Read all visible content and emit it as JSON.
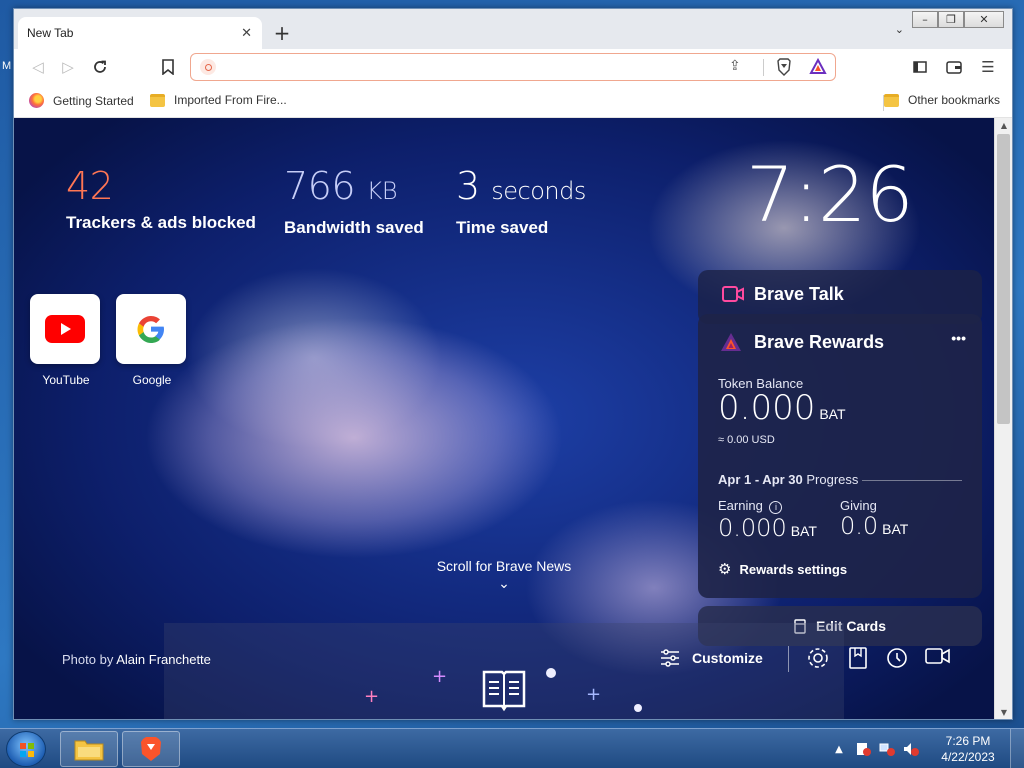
{
  "window": {
    "controls": [
      "–",
      "❐",
      "✕"
    ]
  },
  "tabs": [
    {
      "title": "New Tab",
      "close": "✕"
    }
  ],
  "new_tab_symbol": "+",
  "tab_search_symbol": "⌄",
  "address_bar": {
    "value": "",
    "placeholder": ""
  },
  "bookmarks": [
    {
      "label": "Getting Started",
      "icon": "firefox-icon"
    },
    {
      "label": "Imported From Fire...",
      "icon": "folder-icon"
    }
  ],
  "other_bookmarks": "Other bookmarks",
  "stats": {
    "trackers": {
      "value": "42",
      "label": "Trackers & ads blocked",
      "color": "#ff7654"
    },
    "bandwidth": {
      "value": "766",
      "unit": "KB",
      "label": "Bandwidth saved",
      "color": "#c6cdf7"
    },
    "time": {
      "value": "3",
      "unit": "seconds",
      "label": "Time saved",
      "color": "#ffffff"
    }
  },
  "clock": "7:26",
  "top_sites": [
    {
      "label": "YouTube",
      "icon": "youtube-icon"
    },
    {
      "label": "Google",
      "icon": "google-icon"
    }
  ],
  "brave_talk": {
    "title": "Brave Talk"
  },
  "rewards": {
    "title": "Brave Rewards",
    "menu": "•••",
    "token_balance_label": "Token Balance",
    "balance": "0.000",
    "balance_unit": "BAT",
    "usd": "≈ 0.00 USD",
    "period": "Apr 1 - Apr 30",
    "progress_label": "Progress",
    "earning_label": "Earning",
    "earning_value": "0.000",
    "earning_unit": "BAT",
    "giving_label": "Giving",
    "giving_value": "0.0",
    "giving_unit": "BAT",
    "settings_label": "Rewards settings"
  },
  "edit_cards": "Edit Cards",
  "scroll_news": "Scroll for Brave News",
  "photo_credit": {
    "prefix": "Photo by",
    "author": "Alain Franchette"
  },
  "customize": "Customize",
  "taskbar": {
    "time": "7:26 PM",
    "date": "4/22/2023"
  },
  "colors": {
    "accent": "#fb542b",
    "talk": "#ff4a9f",
    "rewards": "#fb542b"
  }
}
